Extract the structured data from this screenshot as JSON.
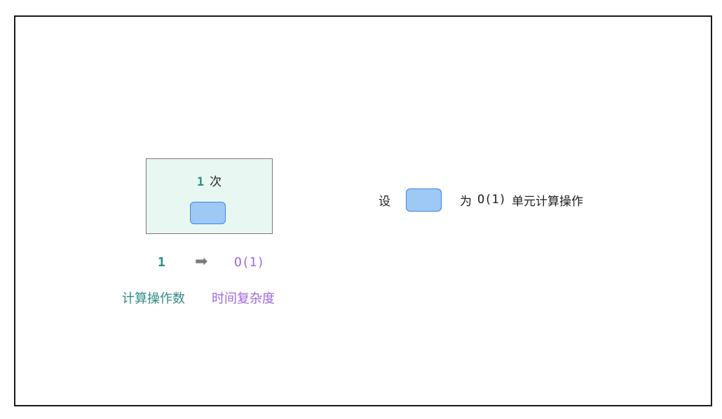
{
  "box": {
    "count": "1",
    "count_suffix": "次"
  },
  "mapping": {
    "ops": "1",
    "arrow": "➡",
    "complexity": "O(1)"
  },
  "captions": {
    "ops_label": "计算操作数",
    "time_label": "时间复杂度"
  },
  "legend": {
    "prefix": "设",
    "middle": "为",
    "complexity": "O(1)",
    "suffix": "单元计算操作"
  },
  "colors": {
    "ops": "#2e8c83",
    "complexity": "#a168e0",
    "box_bg": "#e9f7f3",
    "unit_fill": "#9ec9f5",
    "unit_border": "#3d86d6"
  }
}
